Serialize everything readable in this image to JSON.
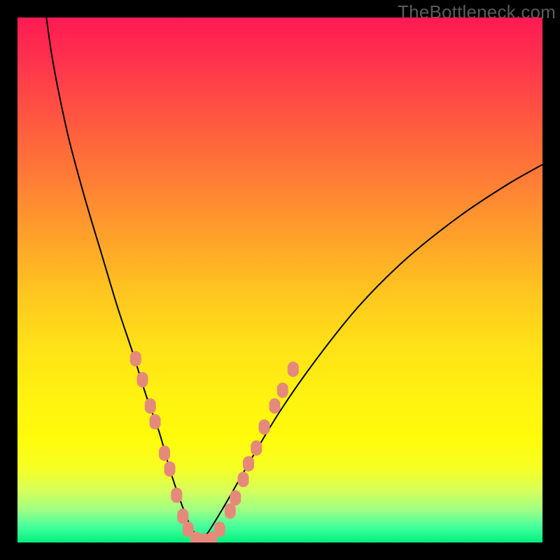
{
  "watermark": "TheBottleneck.com",
  "chart_data": {
    "type": "line",
    "title": "",
    "xlabel": "",
    "ylabel": "",
    "xlim": [
      0,
      100
    ],
    "ylim": [
      0,
      100
    ],
    "series": [
      {
        "name": "left-branch",
        "x": [
          5.5,
          6.5,
          8,
          10,
          13,
          16,
          19,
          22,
          24.5,
          27,
          29,
          31,
          33,
          35
        ],
        "y": [
          100,
          93,
          85,
          76,
          65,
          55,
          45,
          36,
          28,
          21,
          14,
          8,
          3,
          0
        ]
      },
      {
        "name": "right-branch",
        "x": [
          35,
          37,
          40,
          44,
          50,
          57,
          65,
          74,
          84,
          93,
          100
        ],
        "y": [
          0,
          3,
          8,
          15,
          25,
          35,
          45,
          54,
          62,
          68,
          72
        ]
      }
    ],
    "markers_left": [
      {
        "x": 22.5,
        "y": 35
      },
      {
        "x": 23.8,
        "y": 31
      },
      {
        "x": 25.3,
        "y": 26
      },
      {
        "x": 26.2,
        "y": 23
      },
      {
        "x": 28.0,
        "y": 17
      },
      {
        "x": 29.0,
        "y": 14
      },
      {
        "x": 30.3,
        "y": 9
      },
      {
        "x": 31.5,
        "y": 5
      },
      {
        "x": 32.5,
        "y": 2.5
      },
      {
        "x": 34.0,
        "y": 0.6
      },
      {
        "x": 35.5,
        "y": 0.3
      }
    ],
    "markers_right": [
      {
        "x": 37.0,
        "y": 0.6
      },
      {
        "x": 38.5,
        "y": 2.5
      },
      {
        "x": 40.5,
        "y": 6
      },
      {
        "x": 41.5,
        "y": 8.5
      },
      {
        "x": 43.0,
        "y": 12
      },
      {
        "x": 44.0,
        "y": 15
      },
      {
        "x": 45.5,
        "y": 18
      },
      {
        "x": 47.0,
        "y": 22
      },
      {
        "x": 49.0,
        "y": 26
      },
      {
        "x": 50.5,
        "y": 29
      },
      {
        "x": 52.5,
        "y": 33
      }
    ]
  }
}
